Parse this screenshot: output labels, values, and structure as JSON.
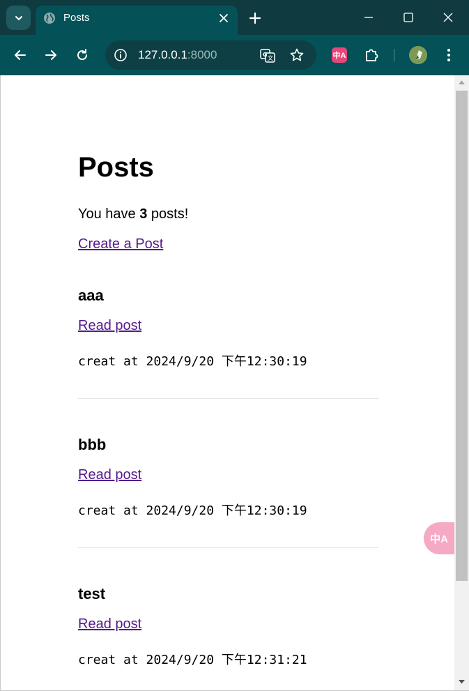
{
  "browser": {
    "tab_title": "Posts",
    "url_host": "127.0.0.1",
    "url_port": ":8000",
    "extension_label": "中A",
    "colors": {
      "frame": "#0f3a3f",
      "toolbar": "#045257",
      "omnibox": "#0d3f44"
    }
  },
  "page": {
    "title": "Posts",
    "summary_prefix": "You have ",
    "post_count": "3",
    "summary_suffix": " posts!",
    "create_link": "Create a Post",
    "posts": [
      {
        "title": "aaa",
        "link": "Read post",
        "date": "creat at 2024/9/20 下午12:30:19"
      },
      {
        "title": "bbb",
        "link": "Read post",
        "date": "creat at 2024/9/20 下午12:30:19"
      },
      {
        "title": "test",
        "link": "Read post",
        "date": "creat at 2024/9/20 下午12:31:21"
      }
    ],
    "colors": {
      "link": "#551a8b",
      "divider": "#e4e4e4"
    }
  },
  "floating_translate_label": "中A"
}
